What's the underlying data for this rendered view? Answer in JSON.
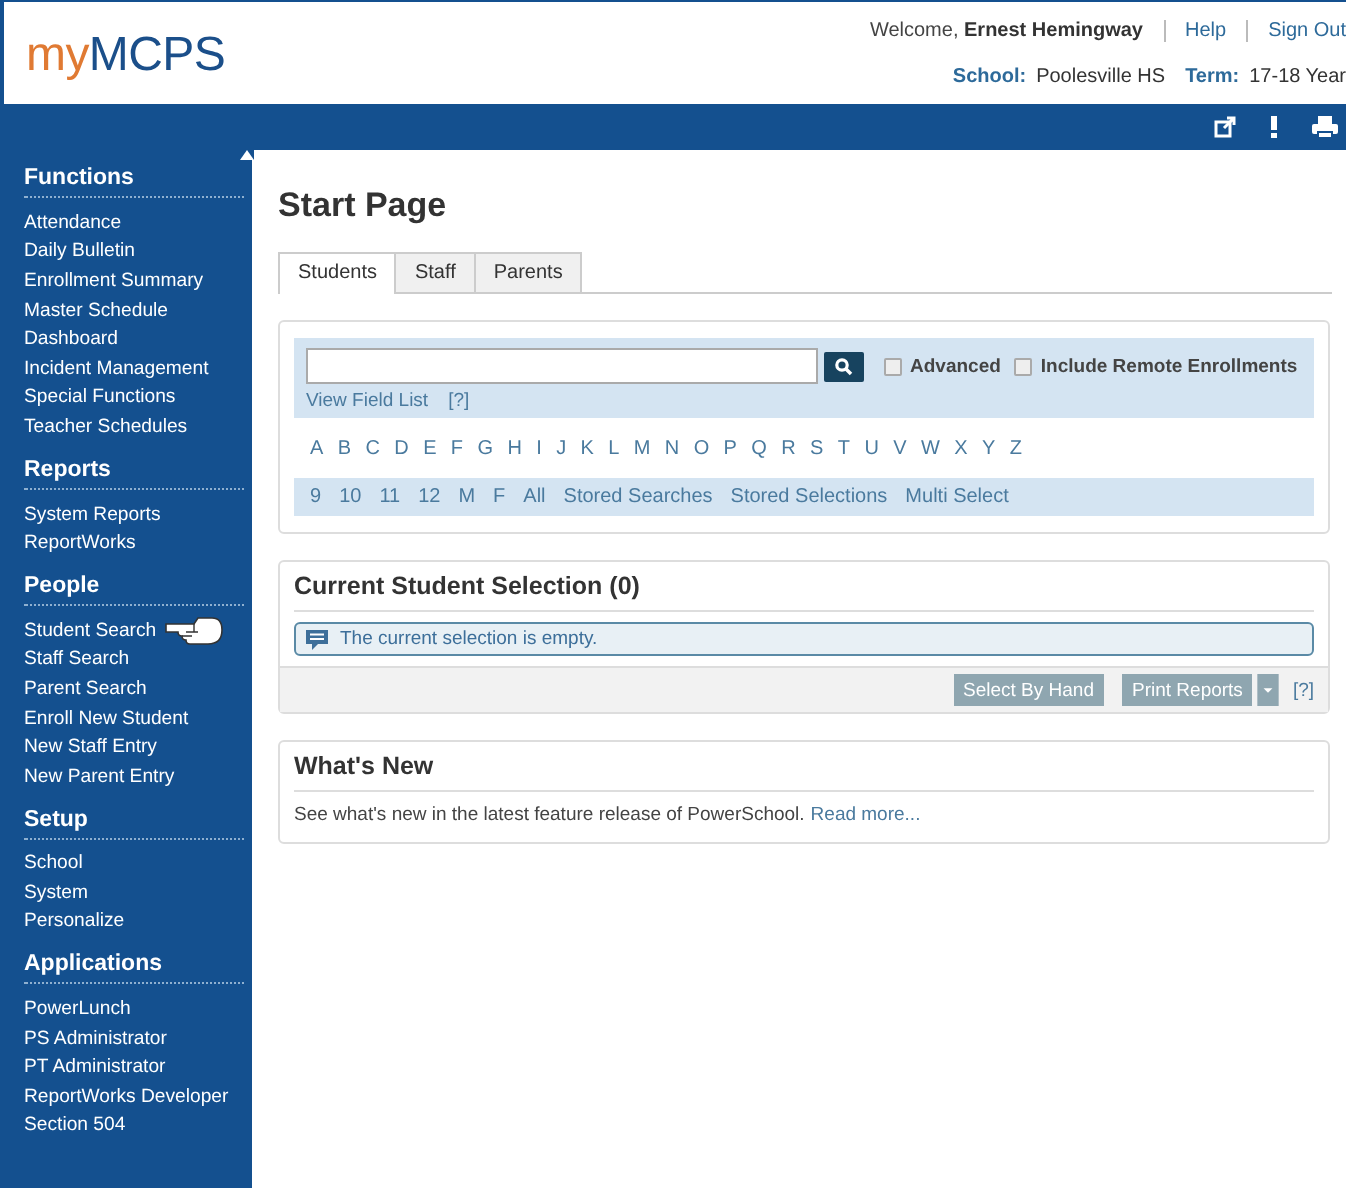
{
  "header": {
    "logo": {
      "prefix": "my",
      "name": "MCPS"
    },
    "welcome": "Welcome, **Ernest Hemingway**",
    "links": [
      "Help",
      "Sign Out"
    ],
    "school_label": "School:",
    "school": "Poolesville HS",
    "term_label": "Term:",
    "term": "17-18 Year"
  },
  "sidebar": [
    {
      "title": "Functions",
      "items": [
        {
          "label": "Attendance",
          "pointed": false
        },
        {
          "label": "Daily Bulletin",
          "pointed": false
        },
        {
          "label": "Enrollment Summary",
          "pointed": false
        },
        {
          "label": "Master Schedule",
          "pointed": false
        },
        {
          "label": "Dashboard",
          "pointed": false
        },
        {
          "label": "Incident Management",
          "pointed": false
        },
        {
          "label": "Special Functions",
          "pointed": false
        },
        {
          "label": "Teacher Schedules",
          "pointed": false
        }
      ]
    },
    {
      "title": "Reports",
      "items": [
        {
          "label": "System Reports",
          "pointed": false
        },
        {
          "label": "ReportWorks",
          "pointed": false
        }
      ]
    },
    {
      "title": "People",
      "items": [
        {
          "label": "Student Search",
          "pointed": true
        },
        {
          "label": "Staff Search",
          "pointed": false
        },
        {
          "label": "Parent Search",
          "pointed": false
        },
        {
          "label": "Enroll New Student",
          "pointed": false
        },
        {
          "label": "New Staff Entry",
          "pointed": false
        },
        {
          "label": "New Parent Entry",
          "pointed": false
        }
      ]
    },
    {
      "title": "Setup",
      "items": [
        {
          "label": "School",
          "pointed": false
        },
        {
          "label": "System",
          "pointed": false
        },
        {
          "label": "Personalize",
          "pointed": false
        }
      ]
    },
    {
      "title": "Applications",
      "items": [
        {
          "label": "PowerLunch",
          "pointed": false
        },
        {
          "label": "PS Administrator",
          "pointed": false
        },
        {
          "label": "PT Administrator",
          "pointed": false
        },
        {
          "label": "ReportWorks Developer",
          "pointed": false
        },
        {
          "label": "Section 504",
          "pointed": false
        }
      ]
    }
  ],
  "page_title": "Start Page",
  "tabs": [
    {
      "label": "Students",
      "selected": true
    },
    {
      "label": "Staff",
      "selected": false
    },
    {
      "label": "Parents",
      "selected": false
    }
  ],
  "search": {
    "options": [
      {
        "label": "Advanced",
        "checked": false
      },
      {
        "label": "Include Remote Enrollments",
        "checked": false
      }
    ],
    "field_list": "View Field List",
    "help": "[?]",
    "letters": [
      "A",
      "B",
      "C",
      "D",
      "E",
      "F",
      "G",
      "H",
      "I",
      "J",
      "K",
      "L",
      "M",
      "N",
      "O",
      "P",
      "Q",
      "R",
      "S",
      "T",
      "U",
      "V",
      "W",
      "X",
      "Y",
      "Z"
    ],
    "filters": [
      "9",
      "10",
      "11",
      "12",
      "M",
      "F",
      "All",
      "Stored Searches",
      "Stored Selections",
      "Multi Select"
    ]
  },
  "selection": {
    "title": "Current Student Selection (0)",
    "message": "The current selection is empty.",
    "buttons": [
      "Select By Hand",
      "Print Reports"
    ],
    "help": "[?]"
  },
  "whats_new": {
    "title": "What's New",
    "text": "See what's new in the latest feature release of PowerSchool.",
    "link": "Read more..."
  }
}
